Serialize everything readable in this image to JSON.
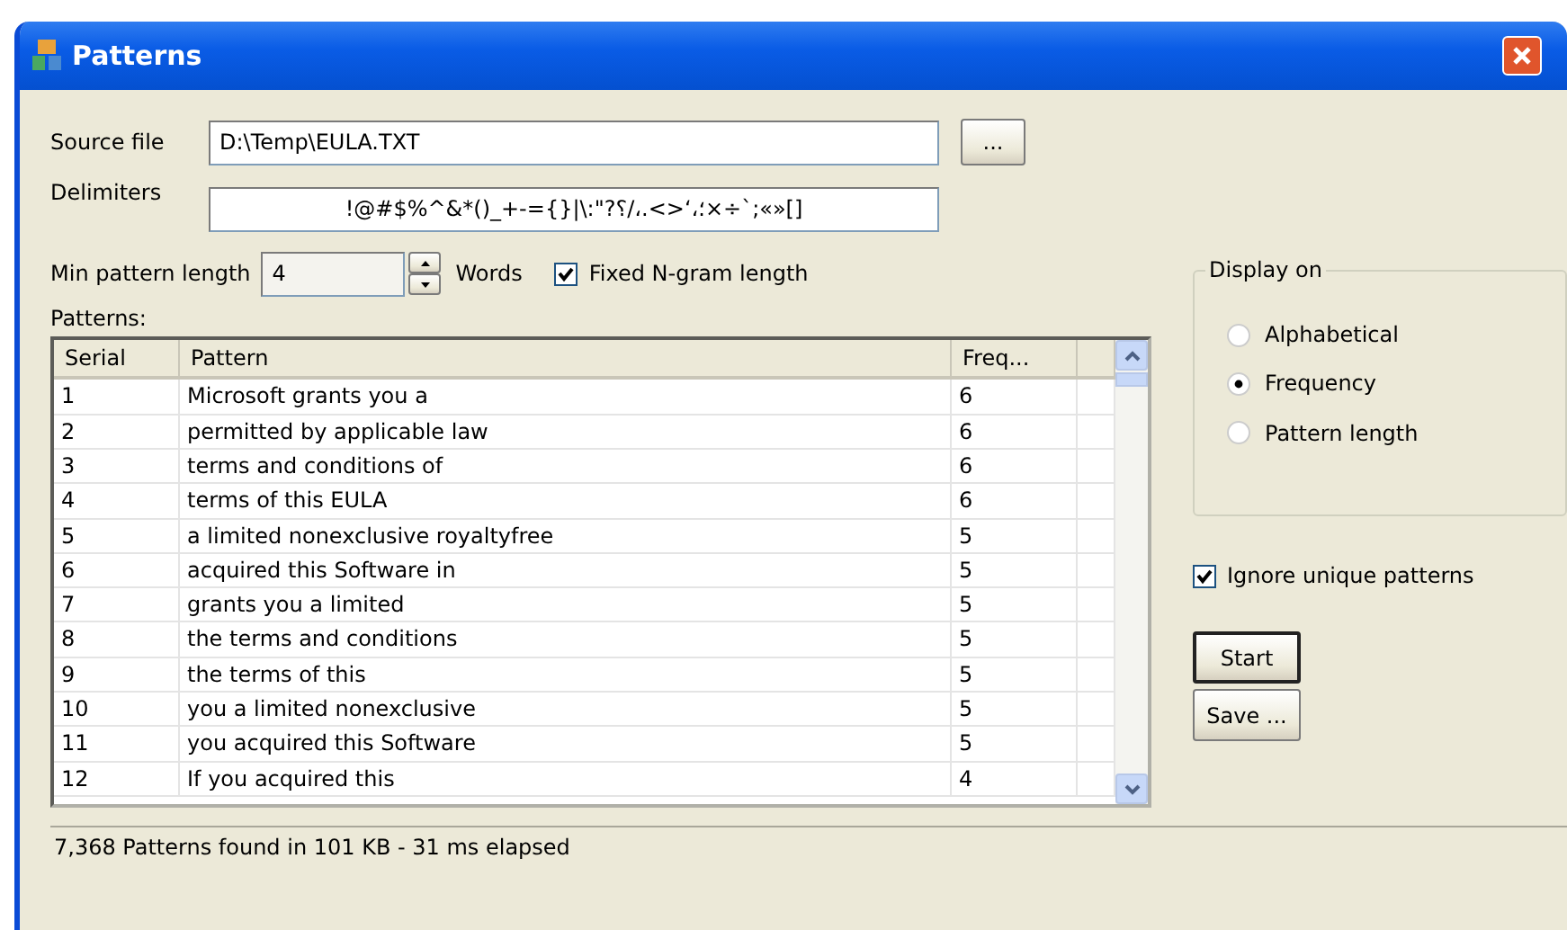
{
  "window": {
    "title": "Patterns"
  },
  "source_file": {
    "label": "Source file",
    "value": "D:\\Temp\\EULA.TXT",
    "browse_button": "..."
  },
  "delimiters": {
    "label": "Delimiters",
    "value": "!@#$%^&*()_+-={}|\\:\"?؛،‘<>.،/؟×÷`;«»[]"
  },
  "min_pattern_length": {
    "label": "Min pattern length",
    "value": "4",
    "unit": "Words"
  },
  "fixed_ngram": {
    "label": "Fixed N-gram length",
    "checked": true
  },
  "patterns_label": "Patterns:",
  "table": {
    "columns": [
      "Serial",
      "Pattern",
      "Freq..."
    ],
    "rows": [
      [
        "1",
        "Microsoft grants you a",
        "6"
      ],
      [
        "2",
        "permitted by applicable law",
        "6"
      ],
      [
        "3",
        "terms and conditions of",
        "6"
      ],
      [
        "4",
        "terms of this EULA",
        "6"
      ],
      [
        "5",
        "a limited nonexclusive royaltyfree",
        "5"
      ],
      [
        "6",
        "acquired this Software in",
        "5"
      ],
      [
        "7",
        "grants you a limited",
        "5"
      ],
      [
        "8",
        "the terms and conditions",
        "5"
      ],
      [
        "9",
        "the terms of this",
        "5"
      ],
      [
        "10",
        "you a limited nonexclusive",
        "5"
      ],
      [
        "11",
        "you acquired this Software",
        "5"
      ],
      [
        "12",
        "If you acquired this",
        "4"
      ]
    ]
  },
  "display_on": {
    "title": "Display on",
    "options": [
      {
        "label": "Alphabetical",
        "selected": false
      },
      {
        "label": "Frequency",
        "selected": true
      },
      {
        "label": "Pattern length",
        "selected": false
      }
    ]
  },
  "ignore_unique": {
    "label": "Ignore unique patterns",
    "checked": true
  },
  "buttons": [
    "Start",
    "Save ..."
  ],
  "status_bar": "7,368 Patterns found in 101 KB - 31 ms elapsed"
}
